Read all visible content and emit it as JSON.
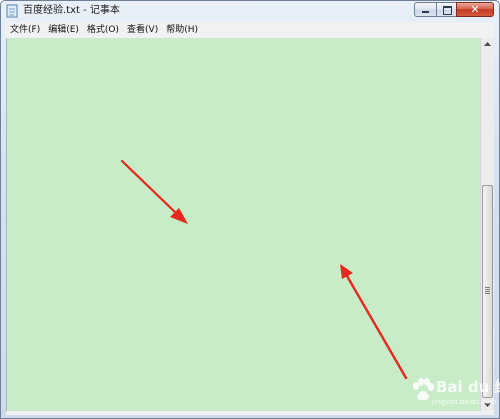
{
  "window": {
    "title": "百度经验.txt - 记事本"
  },
  "menu": {
    "items": [
      "文件(F)",
      "编辑(E)",
      "格式(O)",
      "查看(V)",
      "帮助(H)"
    ]
  },
  "editor": {
    "text": "",
    "background_color": "#c8ebc8"
  },
  "scrollbar": {
    "thumb_position_fraction": 0.42
  },
  "annotations": {
    "arrow_color": "#e8271e"
  },
  "watermark": {
    "logo": "Bai du 经验",
    "url": "jingyan.baidu.com"
  },
  "icons": {
    "app": "notepad-icon",
    "minimize": "minimize-icon",
    "maximize": "maximize-icon",
    "close": "close-icon",
    "scroll_up": "arrow-up-icon",
    "scroll_down": "arrow-down-icon"
  }
}
